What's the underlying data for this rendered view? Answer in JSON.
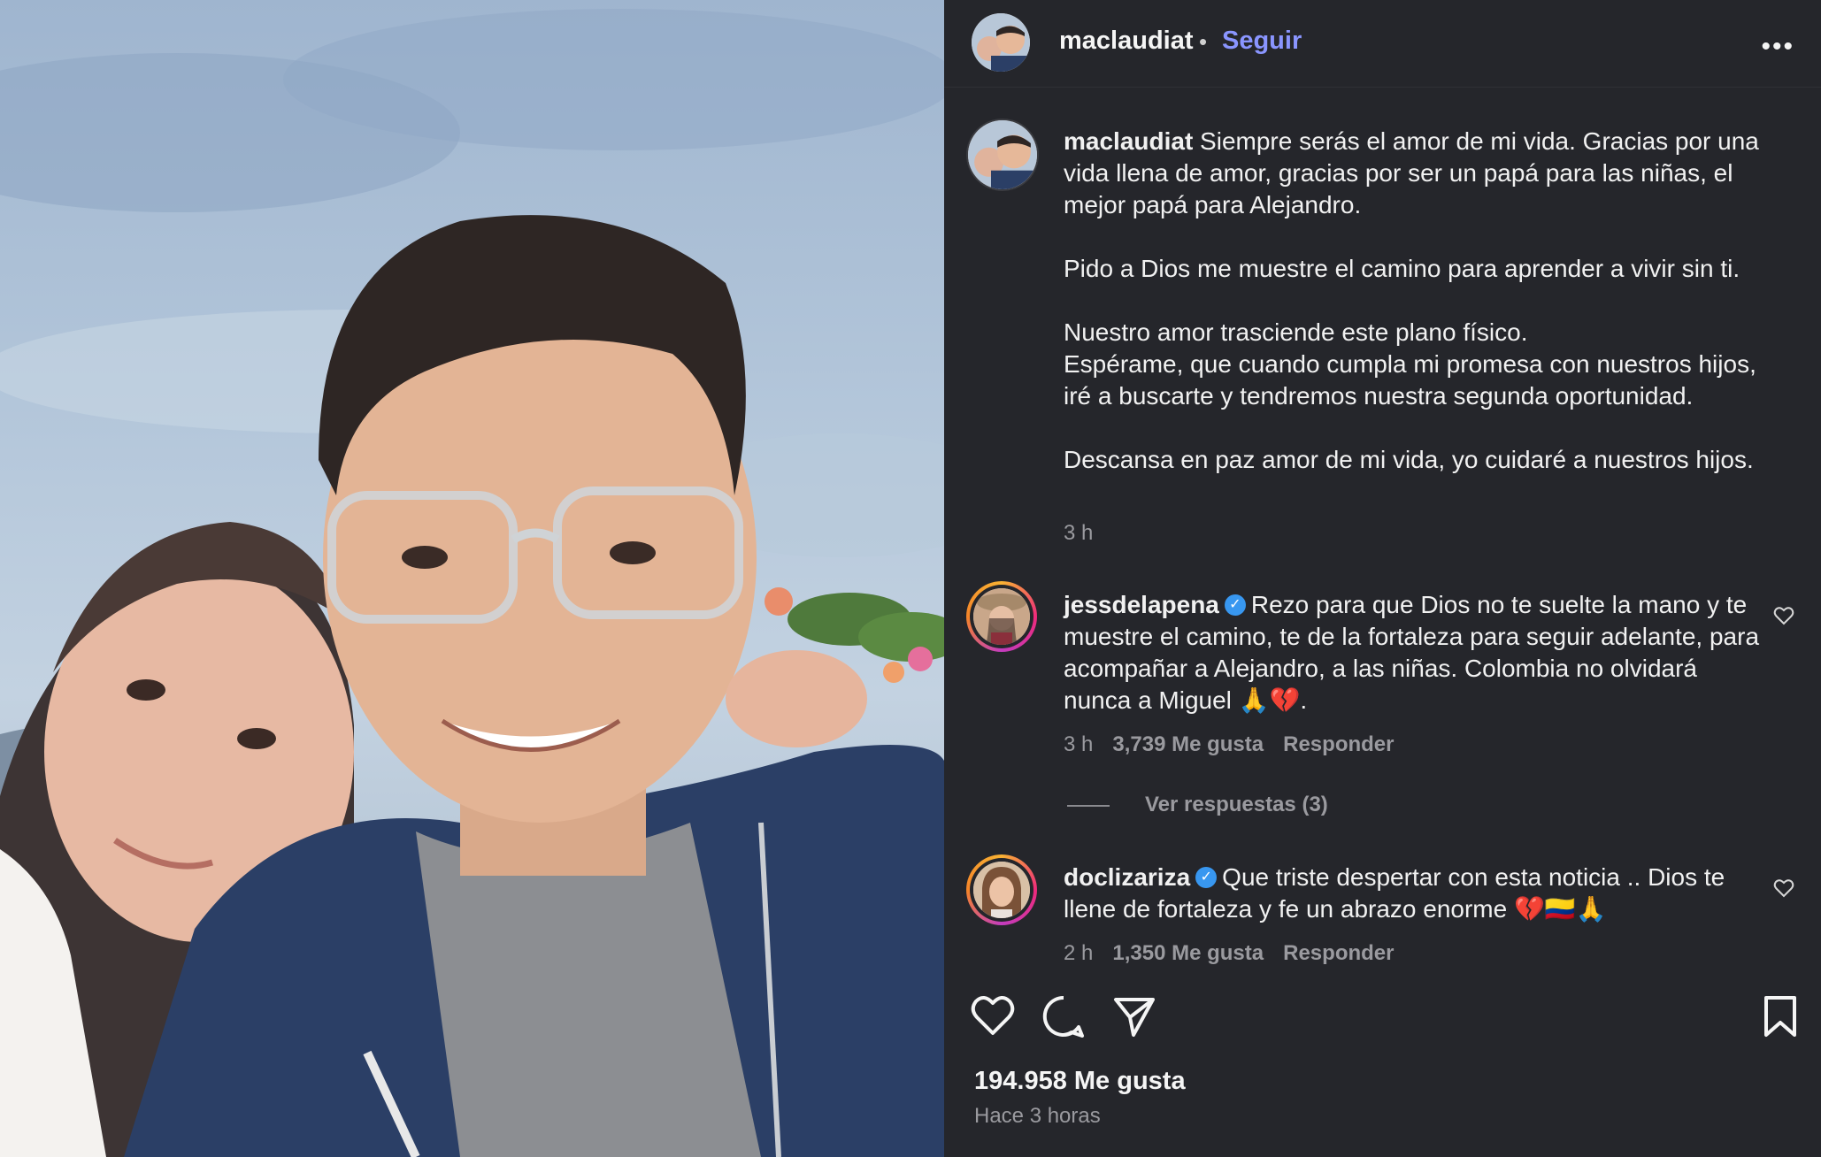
{
  "photo": {
    "alt_subject": "selfie"
  },
  "header": {
    "username": "maclaudiat",
    "separator": "•",
    "follow_label": "Seguir",
    "more_label": "•••"
  },
  "caption": {
    "username": "maclaudiat",
    "text": " Siempre serás el amor de mi vida. Gracias por una vida llena de amor, gracias por ser un papá para las niñas, el mejor papá para Alejandro.\n\nPido a Dios me muestre el camino para aprender a vivir sin ti.\n\nNuestro amor trasciende este plano físico.\nEspérame, que cuando cumpla mi promesa con nuestros hijos, iré a buscarte y tendremos nuestra segunda oportunidad.\n\nDescansa en paz amor de mi vida, yo cuidaré a nuestros hijos.",
    "time": "3 h"
  },
  "comments": [
    {
      "username": "jessdelapena",
      "verified_mark": "✓",
      "text": "Rezo para que Dios no te suelte la mano y te muestre el camino, te de la fortaleza para seguir adelante, para acompañar a Alejandro, a las niñas. Colombia no olvidará nunca a Miguel 🙏💔.",
      "time": "3 h",
      "likes": "3,739 Me gusta",
      "reply": "Responder",
      "view_replies": "Ver respuestas (3)"
    },
    {
      "username": "doclizariza",
      "verified_mark": "✓",
      "text": "Que triste despertar con esta noticia .. Dios te llene de fortaleza y fe un abrazo enorme 💔🇨🇴🙏",
      "time": "2 h",
      "likes": "1,350 Me gusta",
      "reply": "Responder"
    }
  ],
  "footer": {
    "likes": "194.958 Me gusta",
    "time": "Hace 3 horas"
  },
  "icons": [
    "heart-icon",
    "comment-icon",
    "share-icon",
    "bookmark-icon",
    "more-icon",
    "verified-icon"
  ]
}
